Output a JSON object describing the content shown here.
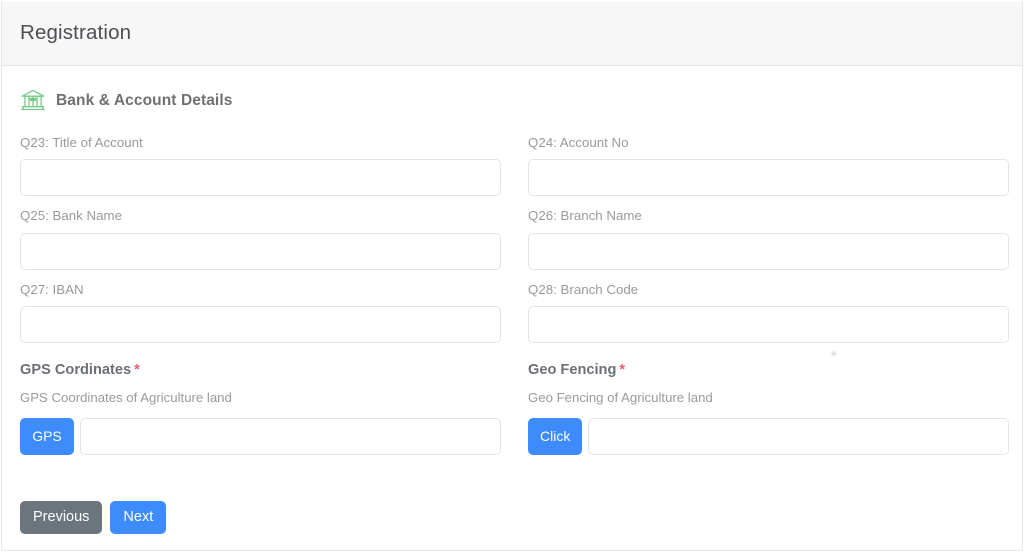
{
  "header": {
    "title": "Registration"
  },
  "section": {
    "icon": "bank-building-icon",
    "title": "Bank & Account Details",
    "icon_color": "#7bc98a"
  },
  "fields": [
    {
      "name": "title-of-account",
      "label": "Q23: Title of Account",
      "value": "",
      "placeholder": ""
    },
    {
      "name": "account-no",
      "label": "Q24: Account No",
      "value": "",
      "placeholder": ""
    },
    {
      "name": "bank-name",
      "label": "Q25: Bank Name",
      "value": "",
      "placeholder": ""
    },
    {
      "name": "branch-name",
      "label": "Q26: Branch Name",
      "value": "",
      "placeholder": ""
    },
    {
      "name": "iban",
      "label": "Q27: IBAN",
      "value": "",
      "placeholder": ""
    },
    {
      "name": "branch-code",
      "label": "Q28: Branch Code",
      "value": "",
      "placeholder": ""
    }
  ],
  "artifact": {
    "glyph": "✳"
  },
  "gps": {
    "title": "GPS Cordinates",
    "required_mark": "*",
    "subtitle": "GPS Coordinates of Agriculture land",
    "button_label": "GPS",
    "value": "",
    "placeholder": ""
  },
  "geofencing": {
    "title": "Geo Fencing",
    "required_mark": "*",
    "subtitle": "Geo Fencing of Agriculture land",
    "button_label": "Click",
    "value": "",
    "placeholder": ""
  },
  "actions": {
    "previous_label": "Previous",
    "next_label": "Next"
  },
  "colors": {
    "primary_blue": "#3d8bfd",
    "secondary_gray": "#6c757d",
    "required_red": "#e4606d",
    "header_bg": "#f7f7f7",
    "border": "#e6e6e6"
  }
}
